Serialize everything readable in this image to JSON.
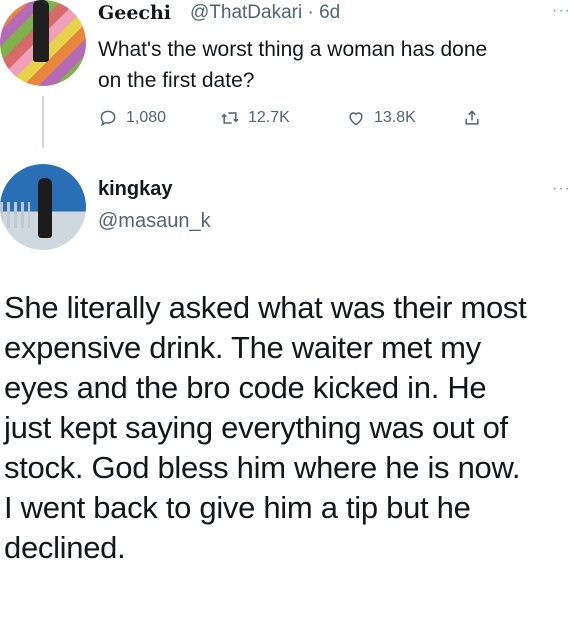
{
  "original_tweet": {
    "display_name": "Geechi",
    "handle": "@ThatDakari",
    "age": "6d",
    "text_line1": "What's the worst thing a woman has done",
    "text_line2": "on the first date?",
    "replies": "1,080",
    "retweets": "12.7K",
    "likes": "13.8K",
    "more": "···"
  },
  "reply_tweet": {
    "display_name": "kingkay",
    "handle": "@masaun_k",
    "more": "···",
    "lines": [
      "She literally asked what was their most",
      "expensive drink. The waiter met my",
      "eyes and the bro code kicked in. He",
      "just kept saying everything was out of",
      "stock. God bless him where he is now.",
      "I went back to give him a tip but he",
      "declined."
    ]
  },
  "icons": [
    "reply-icon",
    "retweet-icon",
    "like-icon",
    "share-icon"
  ],
  "colors": {
    "text": "#14171a",
    "secondary": "#536471",
    "thread_line": "#cfd9de"
  }
}
